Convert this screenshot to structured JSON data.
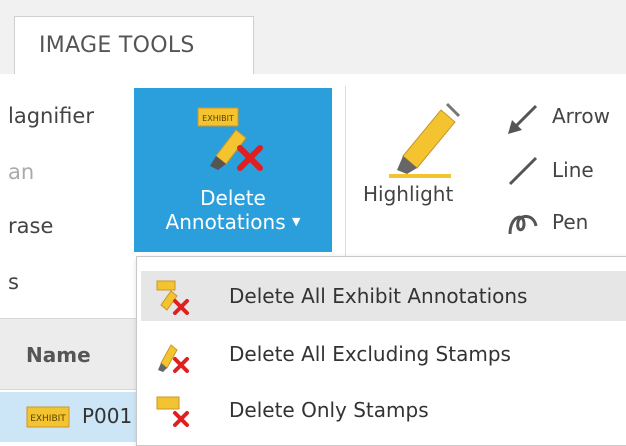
{
  "tab": {
    "label": "IMAGE TOOLS"
  },
  "left_partial": {
    "magnifier": "lagnifier",
    "pan": "an",
    "erase": "rase",
    "s": "s"
  },
  "delete_annotations": {
    "line1": "Delete",
    "line2": "Annotations"
  },
  "highlight": {
    "label": "Highlight"
  },
  "tools": {
    "arrow": "Arrow",
    "line": "Line",
    "pen": "Pen"
  },
  "grid": {
    "header_name": "Name",
    "row_value": "P001"
  },
  "menu": {
    "items": [
      {
        "label": "Delete All Exhibit Annotations",
        "icon": "delete-exhibit-annotations-icon"
      },
      {
        "label": "Delete All Excluding Stamps",
        "icon": "delete-excluding-stamps-icon"
      },
      {
        "label": "Delete Only Stamps",
        "icon": "delete-stamps-icon"
      }
    ]
  },
  "icon_text": {
    "exhibit": "EXHIBIT"
  },
  "colors": {
    "accent": "#2b9fdb",
    "highlight_yellow": "#f4c430",
    "delete_red": "#e02020"
  }
}
